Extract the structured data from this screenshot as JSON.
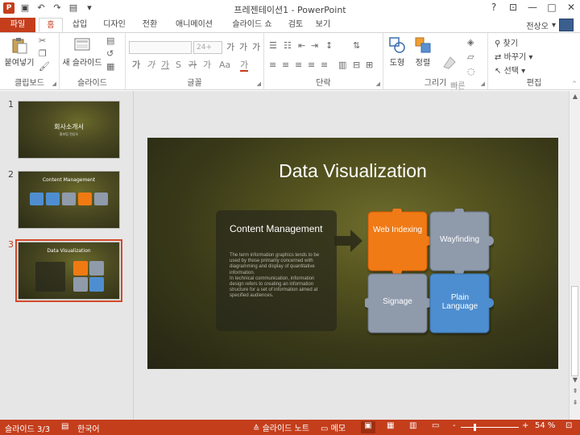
{
  "window": {
    "title": "프레젠테이션1 - PowerPoint",
    "help": "?",
    "minimize": "—",
    "restore": "□",
    "close": "✕"
  },
  "tabs": [
    {
      "label": "파일"
    },
    {
      "label": "홈"
    },
    {
      "label": "삽입"
    },
    {
      "label": "디자인"
    },
    {
      "label": "전환"
    },
    {
      "label": "애니메이션"
    },
    {
      "label": "슬라이드 쇼"
    },
    {
      "label": "검토"
    },
    {
      "label": "보기"
    }
  ],
  "user": {
    "name": "전상오",
    "dropdown": "▾"
  },
  "ribbon": {
    "clipboard": {
      "label": "클립보드",
      "paste": "붙여넣기"
    },
    "slides": {
      "label": "슬라이드",
      "new_slide": "새 슬라이드"
    },
    "font": {
      "label": "글꼴",
      "size": "24+",
      "bold": "가",
      "italic": "가",
      "underline": "가",
      "strike": "가",
      "shadow": "S",
      "spacing": "가",
      "case": "Aa",
      "color": "가",
      "grow": "가",
      "shrink": "가",
      "clear": "가"
    },
    "paragraph": {
      "label": "단락"
    },
    "drawing": {
      "label": "그리기",
      "shape": "도형",
      "arrange": "정렬",
      "quick_styles": "빠른\n스타일"
    },
    "editing": {
      "label": "편집",
      "find": "찾기",
      "replace": "바꾸기",
      "select": "선택"
    }
  },
  "thumbnails": [
    {
      "num": "1",
      "title": "회사소개서",
      "subtitle": "홍보팀 전상오"
    },
    {
      "num": "2",
      "title": "Content Management"
    },
    {
      "num": "3",
      "title": "Data Visualization"
    }
  ],
  "slide": {
    "title": "Data Visualization",
    "cm_title": "Content Management",
    "cm_body": "The term information graphics tends to be used by those primarily concerned with diagramming and display of quantitative information.\nIn technical communication, information design refers to creating an information structure for a set of information aimed at specified audiences.",
    "pieces": [
      {
        "label": "Web Indexing",
        "color": "#f07a12"
      },
      {
        "label": "Wayfinding",
        "color": "#8f9aab"
      },
      {
        "label": "Signage",
        "color": "#8f9aab"
      },
      {
        "label": "Plain Language",
        "color": "#4e8ed0"
      }
    ]
  },
  "status": {
    "slide_info": "슬라이드 3/3",
    "language": "한국어",
    "notes": "슬라이드 노트",
    "comments": "메모",
    "zoom_minus": "-",
    "zoom_plus": "+",
    "zoom": "54 %"
  },
  "colors": {
    "accent": "#c43e1c"
  }
}
